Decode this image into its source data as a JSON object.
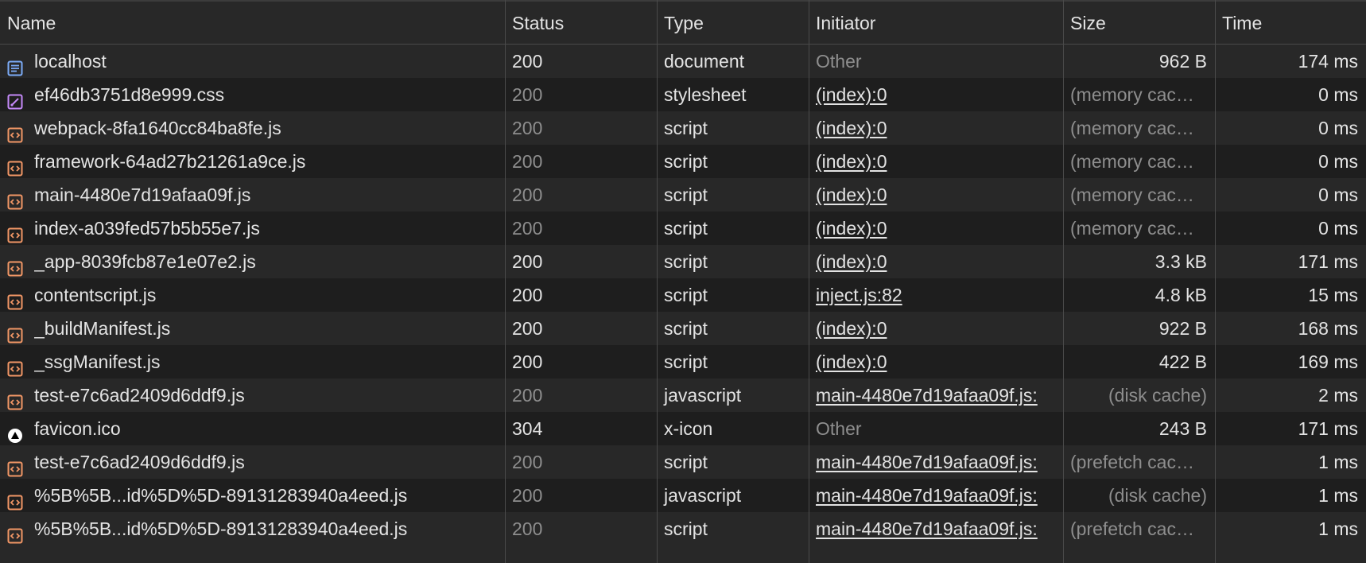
{
  "columns": {
    "name": "Name",
    "status": "Status",
    "type": "Type",
    "initiator": "Initiator",
    "size": "Size",
    "time": "Time"
  },
  "colors": {
    "document_icon": "#7cacf8",
    "stylesheet_icon": "#c58af9",
    "script_icon": "#f29766",
    "favicon_icon": "#000000"
  },
  "rows": [
    {
      "icon": "document-icon",
      "name": "localhost",
      "status": "200",
      "status_muted": false,
      "type": "document",
      "initiator": "Other",
      "initiator_link": false,
      "size": "962 B",
      "size_muted": false,
      "time": "174 ms"
    },
    {
      "icon": "stylesheet-icon",
      "name": "ef46db3751d8e999.css",
      "status": "200",
      "status_muted": true,
      "type": "stylesheet",
      "initiator": "(index):0",
      "initiator_link": true,
      "size": "(memory cac…",
      "size_muted": true,
      "time": "0 ms"
    },
    {
      "icon": "script-icon",
      "name": "webpack-8fa1640cc84ba8fe.js",
      "status": "200",
      "status_muted": true,
      "type": "script",
      "initiator": "(index):0",
      "initiator_link": true,
      "size": "(memory cac…",
      "size_muted": true,
      "time": "0 ms"
    },
    {
      "icon": "script-icon",
      "name": "framework-64ad27b21261a9ce.js",
      "status": "200",
      "status_muted": true,
      "type": "script",
      "initiator": "(index):0",
      "initiator_link": true,
      "size": "(memory cac…",
      "size_muted": true,
      "time": "0 ms"
    },
    {
      "icon": "script-icon",
      "name": "main-4480e7d19afaa09f.js",
      "status": "200",
      "status_muted": true,
      "type": "script",
      "initiator": "(index):0",
      "initiator_link": true,
      "size": "(memory cac…",
      "size_muted": true,
      "time": "0 ms"
    },
    {
      "icon": "script-icon",
      "name": "index-a039fed57b5b55e7.js",
      "status": "200",
      "status_muted": true,
      "type": "script",
      "initiator": "(index):0",
      "initiator_link": true,
      "size": "(memory cac…",
      "size_muted": true,
      "time": "0 ms"
    },
    {
      "icon": "script-icon",
      "name": "_app-8039fcb87e1e07e2.js",
      "status": "200",
      "status_muted": false,
      "type": "script",
      "initiator": "(index):0",
      "initiator_link": true,
      "size": "3.3 kB",
      "size_muted": false,
      "time": "171 ms"
    },
    {
      "icon": "script-icon",
      "name": "contentscript.js",
      "status": "200",
      "status_muted": false,
      "type": "script",
      "initiator": "inject.js:82",
      "initiator_link": true,
      "size": "4.8 kB",
      "size_muted": false,
      "time": "15 ms"
    },
    {
      "icon": "script-icon",
      "name": "_buildManifest.js",
      "status": "200",
      "status_muted": false,
      "type": "script",
      "initiator": "(index):0",
      "initiator_link": true,
      "size": "922 B",
      "size_muted": false,
      "time": "168 ms"
    },
    {
      "icon": "script-icon",
      "name": "_ssgManifest.js",
      "status": "200",
      "status_muted": false,
      "type": "script",
      "initiator": "(index):0",
      "initiator_link": true,
      "size": "422 B",
      "size_muted": false,
      "time": "169 ms"
    },
    {
      "icon": "script-icon",
      "name": "test-e7c6ad2409d6ddf9.js",
      "status": "200",
      "status_muted": true,
      "type": "javascript",
      "initiator": "main-4480e7d19afaa09f.js:",
      "initiator_link": true,
      "size": "(disk cache)",
      "size_muted": true,
      "time": "2 ms"
    },
    {
      "icon": "favicon-icon",
      "name": "favicon.ico",
      "status": "304",
      "status_muted": false,
      "type": "x-icon",
      "initiator": "Other",
      "initiator_link": false,
      "size": "243 B",
      "size_muted": false,
      "time": "171 ms"
    },
    {
      "icon": "script-icon",
      "name": "test-e7c6ad2409d6ddf9.js",
      "status": "200",
      "status_muted": true,
      "type": "script",
      "initiator": "main-4480e7d19afaa09f.js:",
      "initiator_link": true,
      "size": "(prefetch cac…",
      "size_muted": true,
      "time": "1 ms"
    },
    {
      "icon": "script-icon",
      "name": "%5B%5B...id%5D%5D-89131283940a4eed.js",
      "status": "200",
      "status_muted": true,
      "type": "javascript",
      "initiator": "main-4480e7d19afaa09f.js:",
      "initiator_link": true,
      "size": "(disk cache)",
      "size_muted": true,
      "time": "1 ms"
    },
    {
      "icon": "script-icon",
      "name": "%5B%5B...id%5D%5D-89131283940a4eed.js",
      "status": "200",
      "status_muted": true,
      "type": "script",
      "initiator": "main-4480e7d19afaa09f.js:",
      "initiator_link": true,
      "size": "(prefetch cac…",
      "size_muted": true,
      "time": "1 ms"
    }
  ]
}
